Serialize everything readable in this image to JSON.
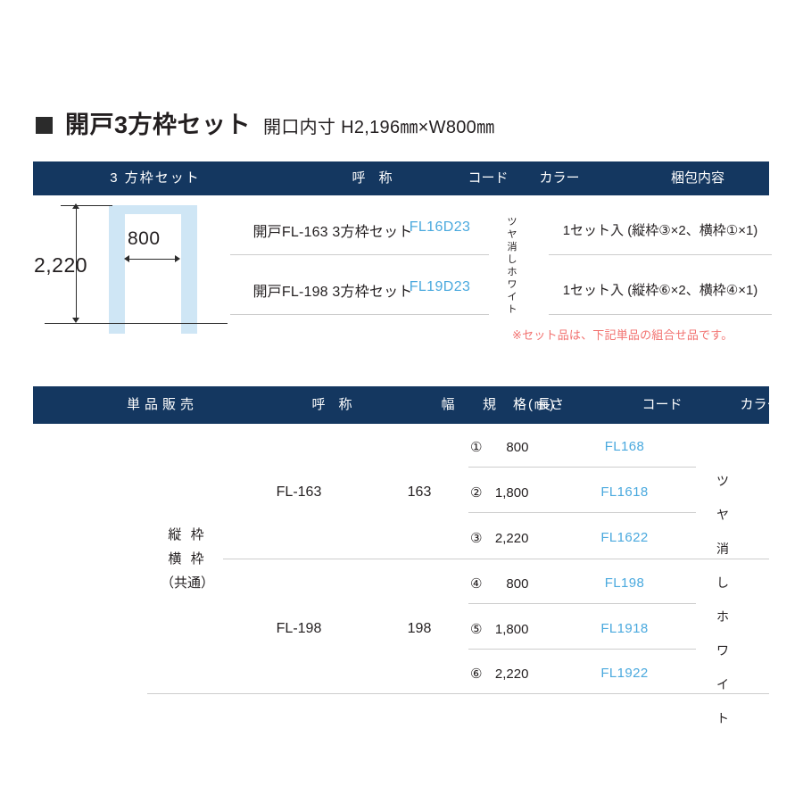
{
  "page": {
    "title_bullet": "■",
    "title_main": "開戸3方枠セット",
    "title_sub": "開口内寸 H2,196㎜×W800㎜",
    "accent_navy": "#143760",
    "accent_code_blue": "#4aa9de",
    "accent_note_red": "#f2716f",
    "frame_blue": "#cfe6f5"
  },
  "diagram": {
    "height_label": "2,220",
    "width_label": "800"
  },
  "set_table": {
    "header": {
      "category": "3 方枠セット",
      "name": "呼　称",
      "code": "コード",
      "color": "カラー",
      "package": "梱包内容"
    },
    "color_vertical": [
      "ツ",
      "ヤ",
      "消",
      "し",
      "ホ",
      "ワ",
      "イ",
      "ト"
    ],
    "rows": [
      {
        "name": "開戸FL-163 3方枠セット",
        "code": "FL16D23",
        "package": "1セット入 (縦枠③×2、横枠①×1)"
      },
      {
        "name": "開戸FL-198 3方枠セット",
        "code": "FL19D23",
        "package": "1セット入 (縦枠⑥×2、横枠④×1)"
      }
    ],
    "note": "※セット品は、下記単品の組合せ品です。"
  },
  "single_table": {
    "header": {
      "category": "単品販売",
      "name": "呼　称",
      "spec": "規　格(㎜)",
      "width": "幅",
      "length": "長さ",
      "code": "コード",
      "color": "カラー"
    },
    "left_label": [
      "縦 枠",
      "横 枠",
      "（共通）"
    ],
    "color_vertical": [
      "ツ",
      "ヤ",
      "消",
      "し",
      "ホ",
      "ワ",
      "イ",
      "ト"
    ],
    "groups": [
      {
        "name": "FL-163",
        "width": "163",
        "items": [
          {
            "mark": "①",
            "length": "800",
            "code": "FL168"
          },
          {
            "mark": "②",
            "length": "1,800",
            "code": "FL1618"
          },
          {
            "mark": "③",
            "length": "2,220",
            "code": "FL1622"
          }
        ]
      },
      {
        "name": "FL-198",
        "width": "198",
        "items": [
          {
            "mark": "④",
            "length": "800",
            "code": "FL198"
          },
          {
            "mark": "⑤",
            "length": "1,800",
            "code": "FL1918"
          },
          {
            "mark": "⑥",
            "length": "2,220",
            "code": "FL1922"
          }
        ]
      }
    ]
  }
}
